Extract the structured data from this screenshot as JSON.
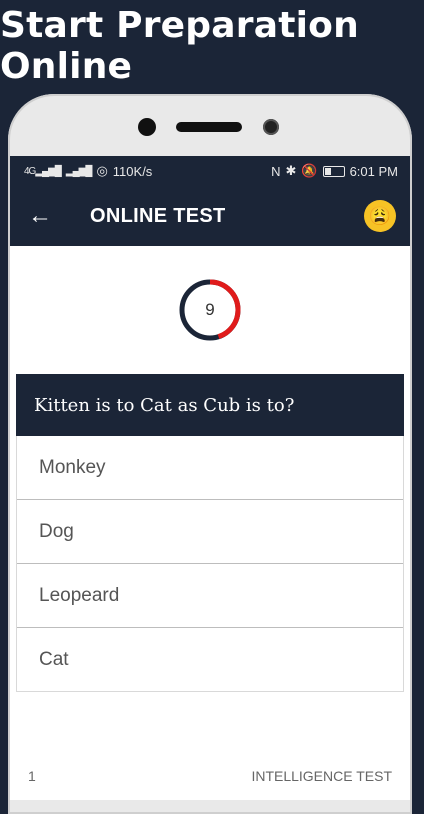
{
  "headline": "Start Preparation Online",
  "status": {
    "network_left": "4G",
    "speed": "110K/s",
    "time": "6:01 PM"
  },
  "appbar": {
    "back_icon": "arrow-left-icon",
    "title": "ONLINE TEST",
    "emoji_icon": "weary-face-icon"
  },
  "timer": {
    "value": "9",
    "progress_fraction": 0.45,
    "ring_color": "#1b2537",
    "progress_color": "#e01b1b"
  },
  "question": {
    "text": "Kitten is to Cat as Cub is to?"
  },
  "options": [
    "Monkey",
    "Dog",
    "Leopeard",
    "Cat"
  ],
  "footer": {
    "page_number": "1",
    "category": "INTELLIGENCE TEST"
  },
  "colors": {
    "primary": "#1b2537",
    "accent": "#e01b1b"
  }
}
